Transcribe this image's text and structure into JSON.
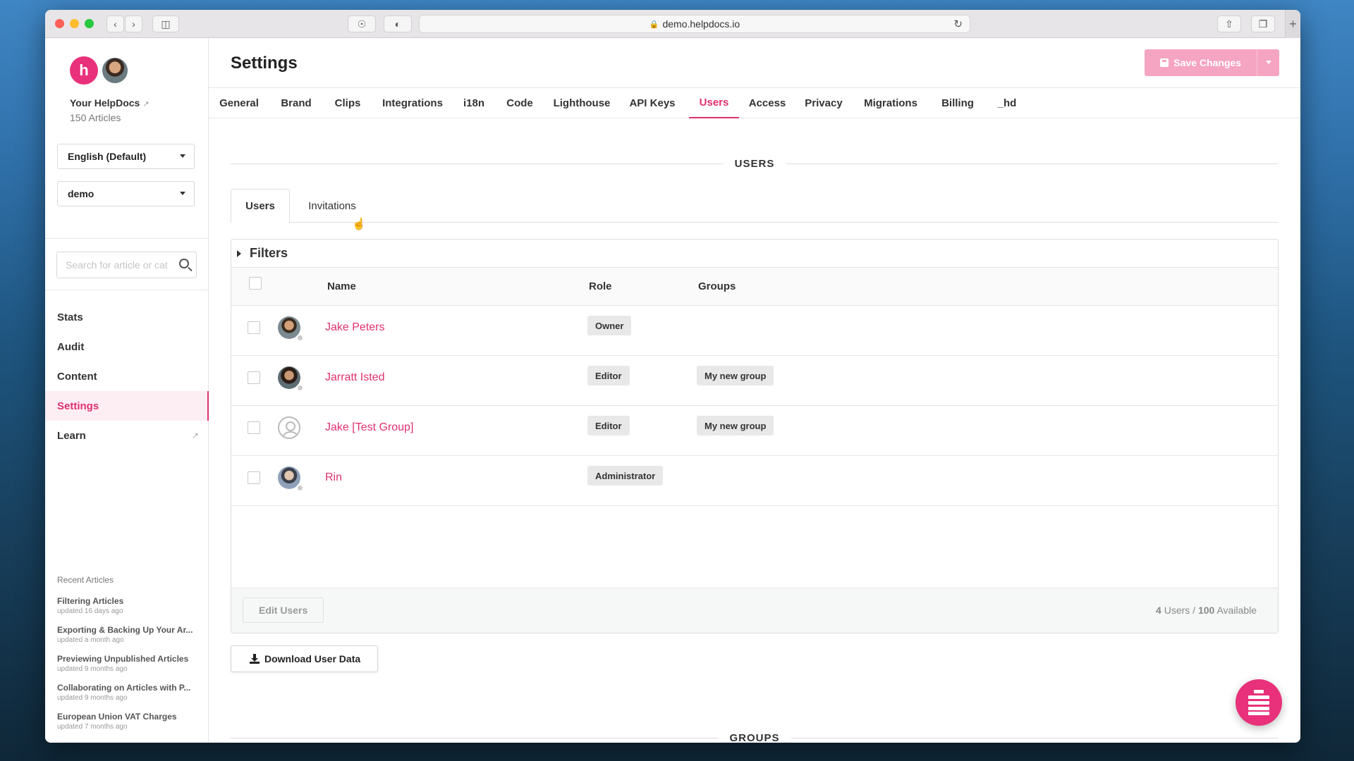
{
  "browser": {
    "url": "demo.helpdocs.io"
  },
  "sidebar": {
    "site_name": "Your HelpDocs",
    "article_count": "150 Articles",
    "language_select": "English (Default)",
    "site_select": "demo",
    "search_placeholder": "Search for article or cat",
    "nav": [
      {
        "label": "Stats"
      },
      {
        "label": "Audit"
      },
      {
        "label": "Content"
      },
      {
        "label": "Settings"
      },
      {
        "label": "Learn"
      }
    ],
    "recent_title": "Recent Articles",
    "recent": [
      {
        "title": "Filtering Articles",
        "updated": "updated 16 days ago"
      },
      {
        "title": "Exporting & Backing Up Your Ar...",
        "updated": "updated a month ago"
      },
      {
        "title": "Previewing Unpublished Articles",
        "updated": "updated 9 months ago"
      },
      {
        "title": "Collaborating on Articles with P...",
        "updated": "updated 9 months ago"
      },
      {
        "title": "European Union VAT Charges",
        "updated": "updated 7 months ago"
      }
    ]
  },
  "header": {
    "title": "Settings",
    "save_label": "Save Changes"
  },
  "tabs": [
    {
      "label": "General"
    },
    {
      "label": "Brand"
    },
    {
      "label": "Clips"
    },
    {
      "label": "Integrations"
    },
    {
      "label": "i18n"
    },
    {
      "label": "Code"
    },
    {
      "label": "Lighthouse"
    },
    {
      "label": "API Keys"
    },
    {
      "label": "Users"
    },
    {
      "label": "Access"
    },
    {
      "label": "Privacy"
    },
    {
      "label": "Migrations"
    },
    {
      "label": "Billing"
    },
    {
      "label": "_hd"
    }
  ],
  "active_tab": "Users",
  "users_section": {
    "heading": "USERS",
    "subtabs": [
      {
        "label": "Users"
      },
      {
        "label": "Invitations"
      }
    ],
    "filters_label": "Filters",
    "columns": {
      "name": "Name",
      "role": "Role",
      "groups": "Groups"
    },
    "rows": [
      {
        "name": "Jake Peters",
        "role": "Owner",
        "group": ""
      },
      {
        "name": "Jarratt Isted",
        "role": "Editor",
        "group": "My new group"
      },
      {
        "name": "Jake [Test Group]",
        "role": "Editor",
        "group": "My new group"
      },
      {
        "name": "Rin",
        "role": "Administrator",
        "group": ""
      }
    ],
    "edit_users_label": "Edit Users",
    "count_users": "4",
    "count_users_suffix": "Users /",
    "count_available": "100",
    "count_available_suffix": "Available",
    "download_label": "Download User Data"
  },
  "groups_section": {
    "heading": "GROUPS"
  },
  "colors": {
    "accent": "#e0306f",
    "save_disabled": "#f5a4c1"
  }
}
